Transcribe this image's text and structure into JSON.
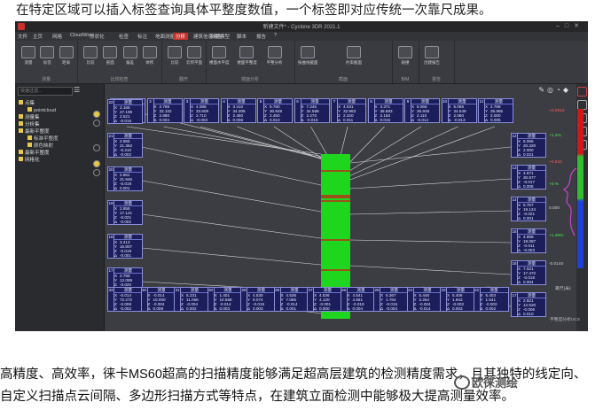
{
  "caption_top": "在特定区域可以插入标签查询具体平整度数值，一个标签即对应传统一次靠尺成果。",
  "app": {
    "title": "新建文件* - Cyclone 3DR 2021.1",
    "window_buttons": [
      "–",
      "□",
      "✕"
    ],
    "menu": [
      "文件",
      "主页",
      "网格",
      "CloudWorx",
      "形状化",
      "检查",
      "标注",
      "地面测量",
      "分析",
      "建筑信息模型",
      "影像模型",
      "脚本",
      "报告",
      "?"
    ],
    "menu_active": "分析",
    "ribbon_groups": [
      {
        "label": "测量",
        "buttons": [
          "测量",
          "标签",
          "距离"
        ]
      },
      {
        "label": "比较检查",
        "buttons": [
          "比较",
          "剖面",
          "偏差",
          "体积"
        ]
      },
      {
        "label": "翻开",
        "buttons": [
          "比较",
          "云到平面"
        ]
      },
      {
        "label": "楼面分析",
        "buttons": [
          "楼面水平度",
          "楼面平整度",
          "平整分析"
        ]
      },
      {
        "label": "截面",
        "buttons": [
          "按曲线截面",
          "约束截面"
        ]
      },
      {
        "label": "BIM",
        "buttons": [
          "碰撞"
        ]
      },
      {
        "label": "报告",
        "buttons": [
          "创建报告"
        ]
      }
    ],
    "search_placeholder": "快速过滤...",
    "tree": [
      {
        "label": "点集",
        "sub": false
      },
      {
        "label": "pointcloud",
        "sub": true
      },
      {
        "label": "测量集",
        "sub": false
      },
      {
        "label": "分析集",
        "sub": false
      },
      {
        "label": "最新平整度",
        "sub": false
      },
      {
        "label": "标准平整度",
        "sub": true
      },
      {
        "label": "颜色映射",
        "sub": true
      },
      {
        "label": "最新平整度",
        "sub": false
      },
      {
        "label": "网格化",
        "sub": false
      }
    ],
    "status": "平整度分析UCS"
  },
  "cards": {
    "top": [
      {
        "idx": "1",
        "head": "测量",
        "X": "6.237",
        "Y": "32.986",
        "Z": "3.320",
        "D": "0.005"
      },
      {
        "idx": "2",
        "head": "测量",
        "X": "2.798",
        "Y": "33.102",
        "Z": "2.880",
        "D": "0.004"
      },
      {
        "idx": "3",
        "head": "测量",
        "X": "4.088",
        "Y": "33.609",
        "Z": "2.710",
        "D": "-0.003"
      },
      {
        "idx": "4",
        "head": "测量",
        "X": "3.410",
        "Y": "34.006",
        "Z": "2.480",
        "D": "0.006"
      },
      {
        "idx": "5",
        "head": "测量",
        "X": "6.760",
        "Y": "30.948",
        "Z": "2.450",
        "D": "0.010"
      },
      {
        "idx": "6",
        "head": "测量",
        "X": "7.245",
        "Y": "34.568",
        "Z": "2.270",
        "D": "-0.015"
      },
      {
        "idx": "7",
        "head": "测量",
        "X": "4.031",
        "Y": "32.963",
        "Z": "2.220",
        "D": "0.011"
      },
      {
        "idx": "8",
        "head": "测量",
        "X": "3.371",
        "Y": "38.663",
        "Z": "2.150",
        "D": "0.015"
      },
      {
        "idx": "9",
        "head": "测量",
        "X": "5.066",
        "Y": "36.849",
        "Z": "2.110",
        "D": "-0.014"
      },
      {
        "idx": "10",
        "head": "测量",
        "X": "5.066",
        "Y": "34.549",
        "Z": "2.060",
        "D": "-0.013"
      },
      {
        "idx": "11",
        "head": "测量",
        "X": "2.798",
        "Y": "35.985",
        "Z": "2.000",
        "D": "0.005"
      }
    ],
    "left": [
      {
        "idx": "22",
        "head": "测量",
        "X": "2.165",
        "Y": "27.199",
        "Z": "2.521",
        "D": "-0.016"
      },
      {
        "idx": "21",
        "head": "测量",
        "X": "2.865",
        "Y": "21.362",
        "Z": "-0.210",
        "D": "-0.002"
      },
      {
        "idx": "20",
        "head": "测量",
        "X": "2.861",
        "Y": "21.846",
        "Z": "-0.019",
        "D": "0.001"
      },
      {
        "idx": "19",
        "head": "测量",
        "X": "2.858",
        "Y": "17.121",
        "Z": "-0.021",
        "D": "-0.002"
      },
      {
        "idx": "18",
        "head": "测量",
        "X": "3.413",
        "Y": "15.807",
        "Z": "-0.019",
        "D": "-0.001"
      },
      {
        "idx": "17",
        "head": "测量",
        "X": "2.788",
        "Y": "12.089",
        "Z": "-0.020",
        "D": "0.001"
      }
    ],
    "right": [
      {
        "idx": "12",
        "head": "测量",
        "X": "5.066",
        "Y": "20.320",
        "Z": "2.000",
        "D": "0.021"
      },
      {
        "idx": "13",
        "head": "测量",
        "X": "4.671",
        "Y": "30.877",
        "Z": "-0.017",
        "D": "0.008"
      },
      {
        "idx": "14",
        "head": "测量",
        "X": "5.757",
        "Y": "19.124",
        "Z": "-0.021",
        "D": "0.001"
      },
      {
        "idx": "15",
        "head": "测量",
        "X": "4.999",
        "Y": "19.087",
        "Z": "-0.011",
        "D": "-0.003"
      },
      {
        "idx": "16",
        "head": "测量",
        "X": "7.021",
        "Y": "17.472",
        "Z": "-0.018",
        "D": "0.004"
      },
      {
        "idx": "17",
        "head": "测量",
        "X": "2.921",
        "Y": "12.520",
        "Z": "-0.006",
        "D": "0.010"
      }
    ],
    "bottom": [
      {
        "idx": "33",
        "head": "测量",
        "X": "-0.014",
        "Y": "72.272",
        "Z": "-0.008",
        "D": "-0.002"
      },
      {
        "idx": "32",
        "head": "测量",
        "X": "-0.014",
        "Y": "10.000",
        "Z": "-0.004",
        "D": "0.008"
      },
      {
        "idx": "31",
        "head": "测量",
        "X": "5.231",
        "Y": "11.058",
        "Z": "-0.004",
        "D": "0.002"
      },
      {
        "idx": "30",
        "head": "测量",
        "X": "1.401",
        "Y": "10.658",
        "Z": "-0.014",
        "D": "0.003"
      },
      {
        "idx": "29",
        "head": "测量",
        "X": "4.530",
        "Y": "9.074",
        "Z": "-0.015",
        "D": "0.003"
      },
      {
        "idx": "28",
        "head": "测量",
        "X": "4.536",
        "Y": "7.065",
        "Z": "-0.014",
        "D": "0.001"
      },
      {
        "idx": "27",
        "head": "测量",
        "X": "4.536",
        "Y": "4.120",
        "Z": "-0.001",
        "D": "0.000"
      },
      {
        "idx": "26",
        "head": "测量",
        "X": "4.541",
        "Y": "4.561",
        "Z": "-0.019",
        "D": "0.004"
      },
      {
        "idx": "25",
        "head": "测量",
        "X": "5.367",
        "Y": "1.764",
        "Z": "-0.015",
        "D": "-0.004"
      },
      {
        "idx": "24",
        "head": "测量",
        "X": "5.446",
        "Y": "2.264",
        "Z": "-0.004",
        "D": "-0.014"
      },
      {
        "idx": "23",
        "head": "测量",
        "X": "5.406",
        "Y": "1.943",
        "Z": "-0.002",
        "D": "0.003"
      },
      {
        "idx": "22",
        "head": "测量",
        "X": "5.403",
        "Y": "1.541",
        "Z": "-0.002",
        "D": "0.002"
      }
    ]
  },
  "color_scale": {
    "labels": [
      "+0.0910",
      "+1.2%",
      "+0.010",
      "+0.%",
      "0.000",
      "+1.36%",
      "-0.0140"
    ],
    "bottom_label": "靠尺(米)",
    "colors": {
      "high": "#d01818",
      "mid": "#2fbf2f",
      "low": "#1e3fd8"
    }
  },
  "caption_bottom": "高精度、高效率，徕卡MS60超高的扫描精度能够满足超高层建筑的检测精度需求，且其独特的线定向、自定义扫描点云间隔、多边形扫描方式等特点，在建筑立面检测中能够极大提高测量效率。",
  "watermark": "欧徕测绘"
}
